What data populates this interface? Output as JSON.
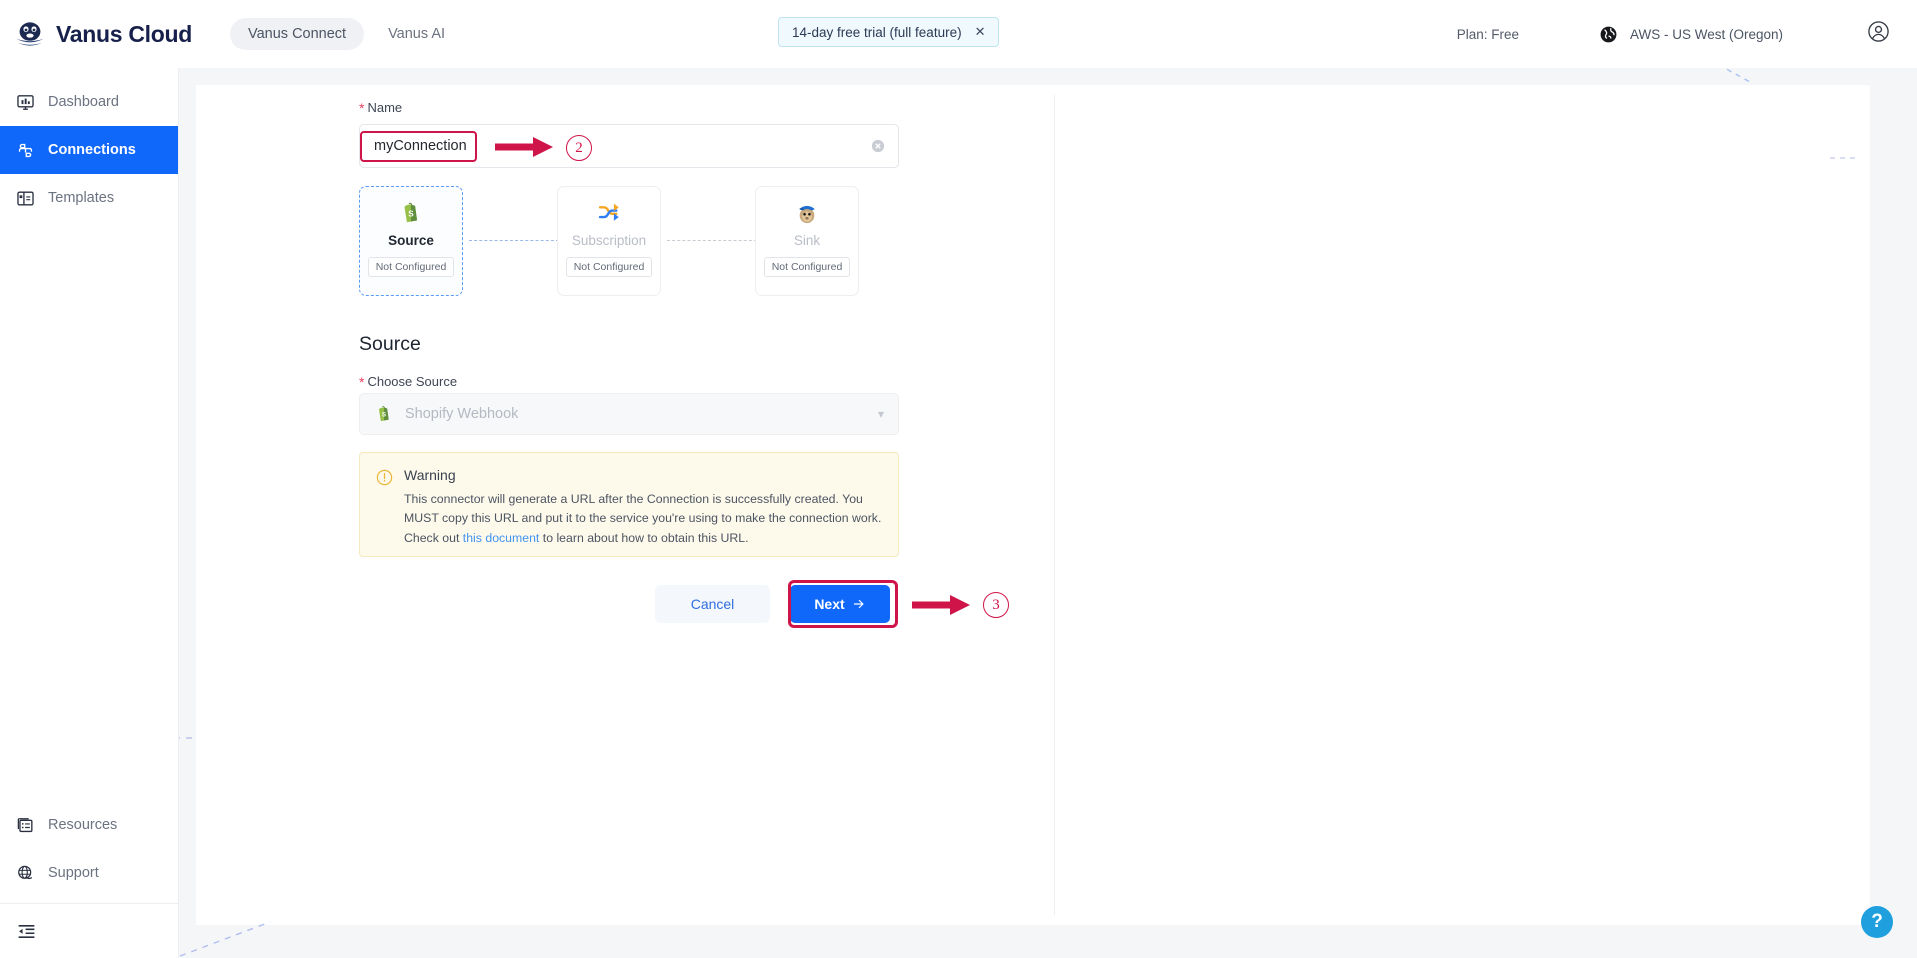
{
  "header": {
    "brand": "Vanus Cloud",
    "logo_icon": "vanus-whale-logo",
    "tabs": [
      {
        "label": "Vanus Connect",
        "active": true
      },
      {
        "label": "Vanus AI",
        "active": false
      }
    ],
    "trial_chip": {
      "label": "14-day free trial (full feature)",
      "close_icon": "close-icon"
    },
    "plan": "Plan: Free",
    "region": "AWS - US West (Oregon)",
    "region_icon": "globe-icon",
    "account_icon": "user-circle-icon"
  },
  "sidebar": {
    "top_items": [
      {
        "label": "Dashboard",
        "icon": "dashboard-icon",
        "active": false
      },
      {
        "label": "Connections",
        "icon": "connections-icon",
        "active": true
      },
      {
        "label": "Templates",
        "icon": "templates-icon",
        "active": false
      }
    ],
    "bottom_items": [
      {
        "label": "Resources",
        "icon": "resources-icon"
      },
      {
        "label": "Support",
        "icon": "support-globe-icon"
      }
    ],
    "collapse_icon": "collapse-sidebar-icon"
  },
  "form": {
    "name_label": "Name",
    "name_value": "myConnection",
    "name_placeholder": "",
    "clear_icon": "clear-circle-icon"
  },
  "steps": [
    {
      "title": "Source",
      "badge": "Not Configured",
      "icon": "shopify-icon",
      "selected": true
    },
    {
      "title": "Subscription",
      "badge": "Not Configured",
      "icon": "subscription-arrows-icon",
      "selected": false
    },
    {
      "title": "Sink",
      "badge": "Not Configured",
      "icon": "mailchimp-icon",
      "selected": false
    }
  ],
  "source_section": {
    "title": "Source",
    "choose_label": "Choose Source",
    "selected_source": "Shopify Webhook",
    "source_icon": "shopify-icon",
    "chevron_icon": "chevron-down-icon"
  },
  "warning": {
    "icon": "warning-exclamation-icon",
    "title": "Warning",
    "body_part1": "This connector will generate a URL after the Connection is successfully created. You MUST copy this URL and put it to the service you're using to make the connection work. Check out ",
    "link_text": "this document",
    "body_part2": " to learn about how to obtain this URL."
  },
  "buttons": {
    "cancel": "Cancel",
    "next": "Next",
    "next_arrow_icon": "arrow-right-icon"
  },
  "annotations": [
    {
      "id": "2",
      "target": "name-input"
    },
    {
      "id": "3",
      "target": "next-button"
    }
  ],
  "help": {
    "label": "?",
    "icon": "help-question-icon"
  },
  "colors": {
    "accent_blue": "#1068fb",
    "annotation_red": "#cf1449",
    "warning_bg": "#fdfaec",
    "warning_border": "#f6e9bd",
    "link_blue": "#4094f2",
    "help_blue": "#1f9fdd"
  }
}
